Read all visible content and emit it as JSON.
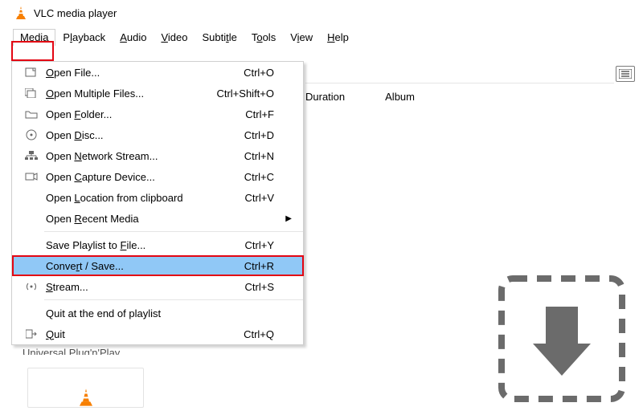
{
  "title": "VLC media player",
  "menubar": [
    {
      "mnemonic": "M",
      "rest": "edia"
    },
    {
      "pre": "P",
      "mnemonic": "l",
      "rest": "ayback"
    },
    {
      "mnemonic": "A",
      "rest": "udio"
    },
    {
      "mnemonic": "V",
      "rest": "ideo"
    },
    {
      "pre": "Subti",
      "mnemonic": "t",
      "rest": "le"
    },
    {
      "pre": "T",
      "mnemonic": "o",
      "rest": "ols"
    },
    {
      "pre": "V",
      "mnemonic": "i",
      "rest": "ew"
    },
    {
      "mnemonic": "H",
      "rest": "elp"
    }
  ],
  "columns": [
    "Duration",
    "Album"
  ],
  "menu": [
    {
      "m": "O",
      "r": "pen File...",
      "s": "Ctrl+O"
    },
    {
      "m": "O",
      "r": "pen Multiple Files...",
      "s": "Ctrl+Shift+O"
    },
    {
      "p": "Open ",
      "m": "F",
      "r": "older...",
      "s": "Ctrl+F"
    },
    {
      "p": "Open ",
      "m": "D",
      "r": "isc...",
      "s": "Ctrl+D"
    },
    {
      "p": "Open ",
      "m": "N",
      "r": "etwork Stream...",
      "s": "Ctrl+N"
    },
    {
      "p": "Open ",
      "m": "C",
      "r": "apture Device...",
      "s": "Ctrl+C"
    },
    {
      "p": "Open ",
      "m": "L",
      "r": "ocation from clipboard",
      "s": "Ctrl+V"
    },
    {
      "p": "Open ",
      "m": "R",
      "r": "ecent Media"
    },
    {
      "p": "Save Playlist to ",
      "m": "F",
      "r": "ile...",
      "s": "Ctrl+Y"
    },
    {
      "p": "Conve",
      "m": "r",
      "r": "t / Save...",
      "s": "Ctrl+R"
    },
    {
      "m": "S",
      "r": "tream...",
      "s": "Ctrl+S"
    },
    {
      "p": "Quit at the end of playlist"
    },
    {
      "m": "Q",
      "r": "uit",
      "s": "Ctrl+Q"
    }
  ],
  "sidebar_peek": "Universal Plug'n'Play",
  "highlight_color": "#e30613",
  "menu_highlight_color": "#90c8f6"
}
